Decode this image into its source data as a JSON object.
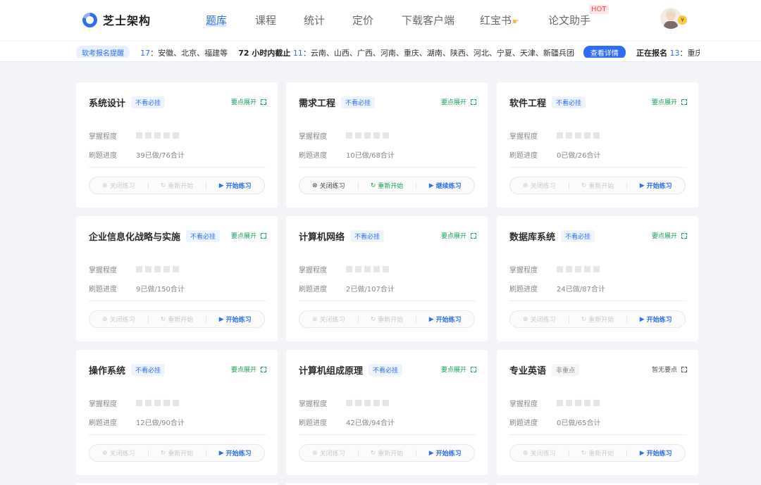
{
  "brand": {
    "name": "芝士架构"
  },
  "nav": {
    "items": [
      {
        "label": "题库",
        "active": true
      },
      {
        "label": "课程"
      },
      {
        "label": "统计"
      },
      {
        "label": "定价"
      },
      {
        "label": "下载客户端"
      },
      {
        "label": "红宝书"
      },
      {
        "label": "论文助手"
      }
    ],
    "hot": "HOT",
    "vip": "¥"
  },
  "notice": {
    "tag": "软考报名提醒",
    "seg1": {
      "num": "17",
      "text": "：安徽、北京、福建等"
    },
    "seg2": {
      "label": "72 小时内截止",
      "num": "11",
      "text": "：云南、山西、广西、河南、重庆、湖南、陕西、河北、宁夏、天津、新疆兵团"
    },
    "detail_btn": "查看详情",
    "seg3": {
      "label": "正在报名",
      "num": "13",
      "text": "：重庆、大连"
    }
  },
  "card_labels": {
    "mastery": "掌握程度",
    "progress": "刷题进度",
    "close": "关闭练习",
    "restart": "重新开始",
    "start": "开始练习",
    "continue": "继续练习"
  },
  "cards": [
    {
      "title": "系统设计",
      "tag": "不看必挂",
      "expand": "要点展开",
      "progress": "39已做/76合计",
      "state": "new"
    },
    {
      "title": "需求工程",
      "tag": "不看必挂",
      "expand": "要点展开",
      "progress": "10已做/68合计",
      "state": "active"
    },
    {
      "title": "软件工程",
      "tag": "不看必挂",
      "expand": "要点展开",
      "progress": "0已做/26合计",
      "state": "new"
    },
    {
      "title": "企业信息化战略与实施",
      "tag": "不看必挂",
      "expand": "要点展开",
      "progress": "9已做/150合计",
      "state": "new"
    },
    {
      "title": "计算机网络",
      "tag": "不看必挂",
      "expand": "要点展开",
      "progress": "2已做/107合计",
      "state": "new"
    },
    {
      "title": "数据库系统",
      "tag": "不看必挂",
      "expand": "要点展开",
      "progress": "24已做/87合计",
      "state": "new"
    },
    {
      "title": "操作系统",
      "tag": "不看必挂",
      "expand": "要点展开",
      "progress": "12已做/90合计",
      "state": "new"
    },
    {
      "title": "计算机组成原理",
      "tag": "不看必挂",
      "expand": "要点展开",
      "progress": "42已做/94合计",
      "state": "new"
    },
    {
      "title": "专业英语",
      "tag": "非重点",
      "tag_style": "gray",
      "expand": "暂无要点",
      "expand_style": "gray",
      "progress": "0已做/65合计",
      "state": "new"
    }
  ],
  "colors": {
    "accent": "#2e6ff2",
    "green": "#19a35c",
    "bg": "#f2f4f8"
  }
}
